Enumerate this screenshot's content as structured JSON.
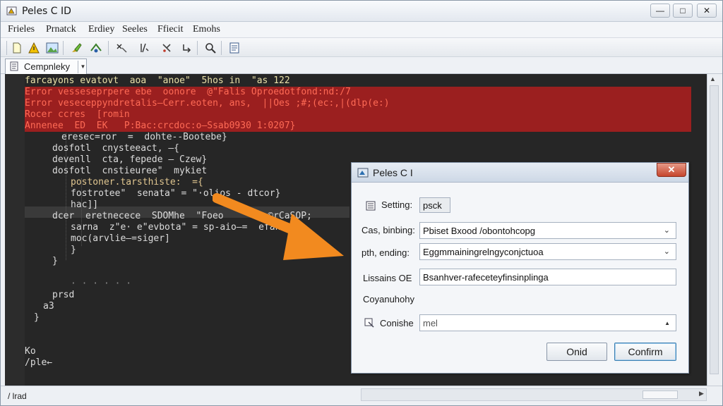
{
  "window": {
    "title": "Peles C ID"
  },
  "menu": [
    "Frieles",
    "Prnatck",
    "Erdiey",
    "Seeles",
    "Ffiecit",
    "Emohs"
  ],
  "tab": {
    "label": "Cempnleky"
  },
  "toolbar_icons": [
    "new-file-icon",
    "warning-icon",
    "image-icon",
    "brush-icon",
    "build-icon",
    "debug-icon",
    "stepover-icon",
    "tools-icon",
    "undo-icon",
    "search-icon",
    "document-icon"
  ],
  "editor": {
    "lines": [
      {
        "text": "farcayons evatovt  aoa  \"anoe\"  5hos in  \"as 122",
        "color": "#e8e0a8",
        "indent": 0
      },
      {
        "text": "Error vesseseprpere ebe  oonore  @\"Falis Oproedotfond:nd:/7",
        "color": "#ff6a55",
        "indent": 0,
        "error": true
      },
      {
        "text": "Error veseceppyndretalis—Cerr.eoten, ans,  ||Oes ;#;(ec:,|(dlp(e:)",
        "color": "#ff6a55",
        "indent": 0,
        "error": true
      },
      {
        "text": "Rocer ccres  [romin",
        "color": "#ff6a55",
        "indent": 0,
        "error": true
      },
      {
        "text": "Annenee  ED  EK   P:Bac:crcdoc:o—Ssab0930 1:0207}",
        "color": "#ff6a55",
        "indent": 0,
        "error": true
      },
      {
        "text": "eresec=ror  =  dohte--Bootebe}",
        "color": "#dcdcdc",
        "indent": 4
      },
      {
        "text": "dosfotl  cnysteeact, —{",
        "color": "#dcdcdc",
        "indent": 3
      },
      {
        "text": "devenll  cta, fepede — Czew}",
        "color": "#dcdcdc",
        "indent": 3
      },
      {
        "text": "dosfotl  cnstieuree\"  mykiet",
        "color": "#dcdcdc",
        "indent": 3
      },
      {
        "text": "postoner.tarsthiste:  ={",
        "color": "#e0c690",
        "indent": 5
      },
      {
        "text": "fostrotee\"  senata\" = \"·olios - dtcor}",
        "color": "#dcdcdc",
        "indent": 5
      },
      {
        "text": "hac]]",
        "color": "#dcdcdc",
        "indent": 5
      },
      {
        "text": "dcer  eretnecece  SDOMhe  \"Foeo      = ©rCaSOP;",
        "color": "#dcdcdc",
        "indent": 3,
        "highlight": true
      },
      {
        "text": "sarna  z\"e· e\"evbota\" = sp-aio—=  efane",
        "color": "#dcdcdc",
        "indent": 5
      },
      {
        "text": "moc(arvlie—=siger]",
        "color": "#dcdcdc",
        "indent": 5
      },
      {
        "text": "}",
        "color": "#dcdcdc",
        "indent": 5
      },
      {
        "text": "}",
        "color": "#dcdcdc",
        "indent": 3
      },
      {
        "text": "",
        "color": "#dcdcdc",
        "indent": 0
      },
      {
        "text": "· · · · · ·",
        "color": "#8a8a8a",
        "indent": 5
      },
      {
        "text": "prsd",
        "color": "#dcdcdc",
        "indent": 3
      },
      {
        "text": "a3",
        "color": "#dcdcdc",
        "indent": 2
      },
      {
        "text": "}",
        "color": "#dcdcdc",
        "indent": 1
      },
      {
        "text": "",
        "color": "#dcdcdc",
        "indent": 0
      },
      {
        "text": "",
        "color": "#dcdcdc",
        "indent": 0
      },
      {
        "text": "Ko",
        "color": "#dcdcdc",
        "indent": 0
      },
      {
        "text": "/ple←",
        "color": "#dcdcdc",
        "indent": 0
      }
    ]
  },
  "status": {
    "text": "/ lrad"
  },
  "dialog": {
    "title": "Peles C I",
    "close_label": "✕",
    "setting_label": "Setting:",
    "setting_value": "psck",
    "fields": [
      {
        "label": "Cas, binbing:",
        "value": "Pbiset Bxood /obontohcopg",
        "dropdown": true
      },
      {
        "label": "pth, ending:",
        "value": "Eggmmainingrelngyconjctuoa",
        "dropdown": true
      },
      {
        "label": "Lissains OE",
        "value": "Bsanhver-rafeceteyfinsinplinga",
        "dropdown": false
      }
    ],
    "section_label": "Coyanuhohy",
    "combo_label": "Conishe",
    "combo_value": "mel",
    "cancel_label": "Onid",
    "confirm_label": "Confirm"
  },
  "colors": {
    "error_band": "#9b1f1f",
    "arrow": "#f28a1f",
    "editor_bg": "#262626",
    "confirm_border": "#3c7fb1"
  }
}
